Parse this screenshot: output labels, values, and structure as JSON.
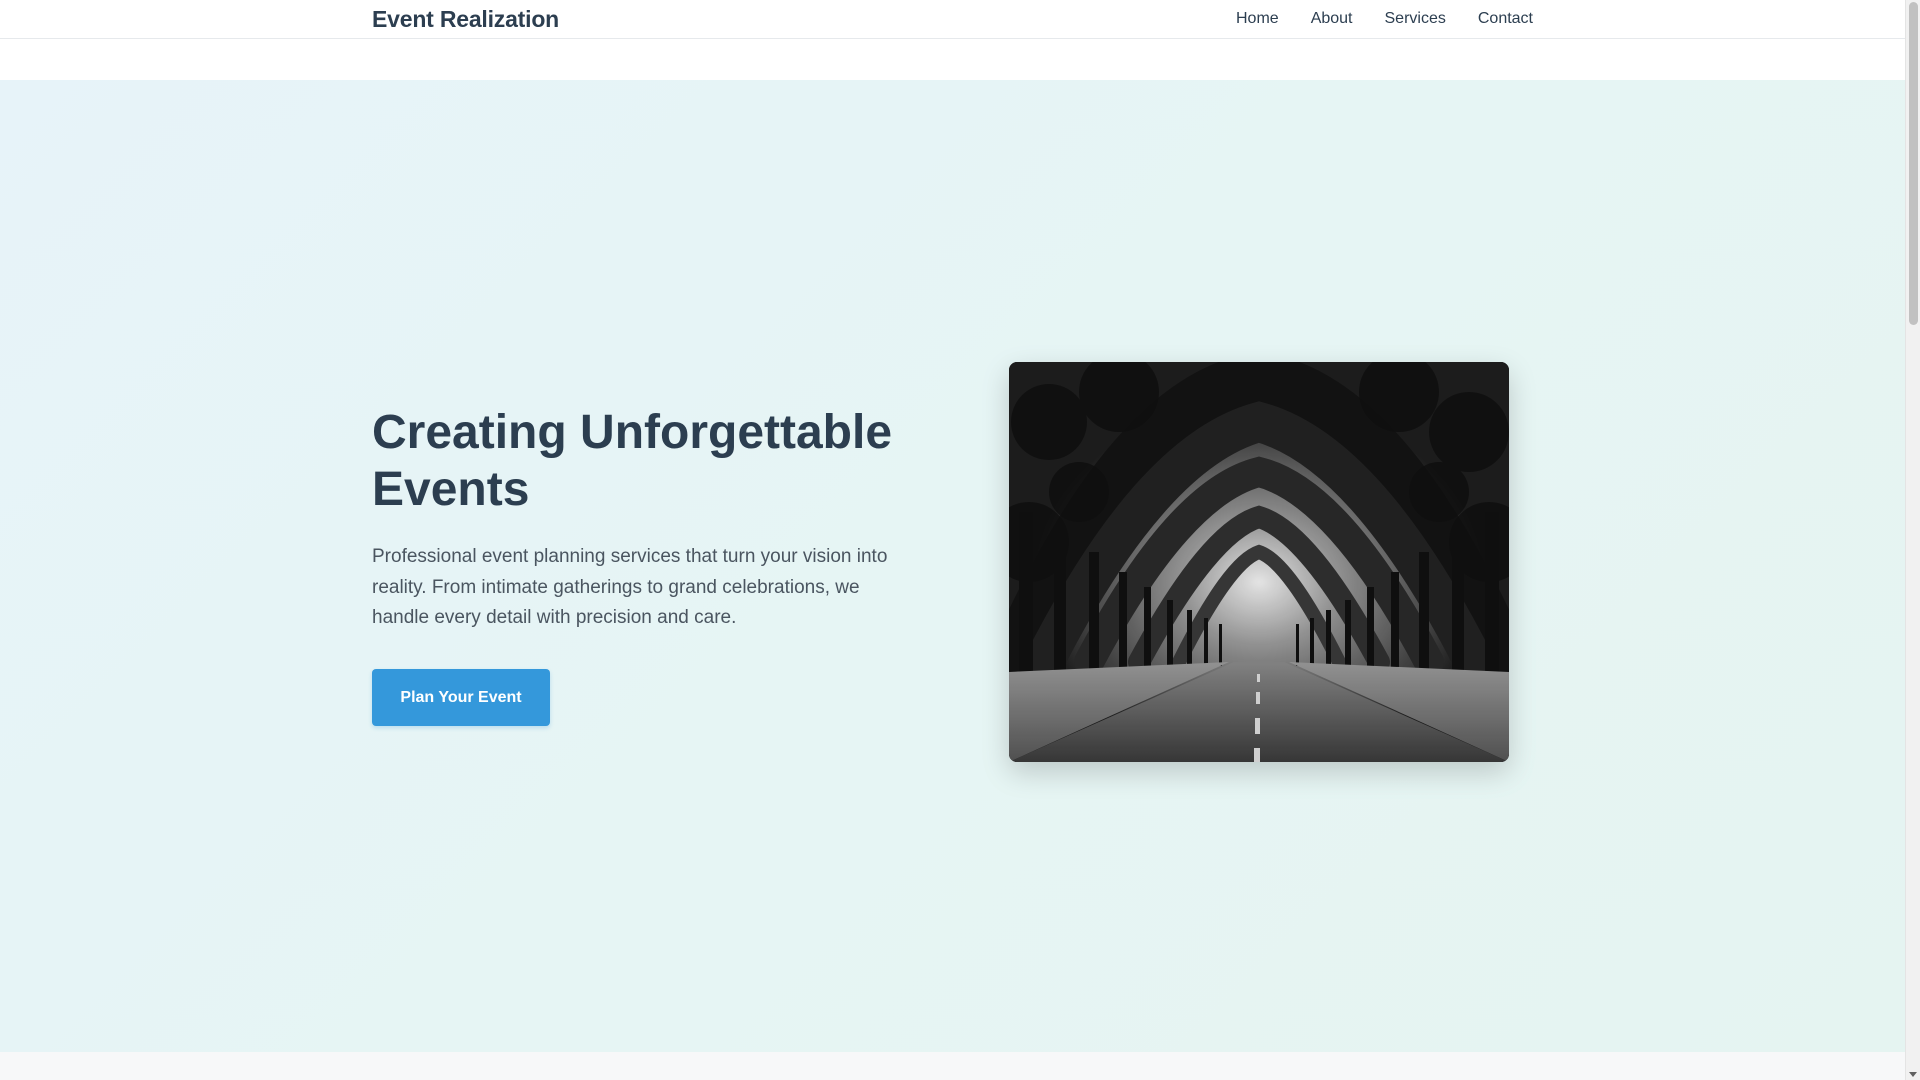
{
  "header": {
    "brand": "Event Realization",
    "nav": [
      {
        "label": "Home"
      },
      {
        "label": "About"
      },
      {
        "label": "Services"
      },
      {
        "label": "Contact"
      }
    ]
  },
  "hero": {
    "title": "Creating Unforgettable Events",
    "description": "Professional event planning services that turn your vision into reality. From intimate gatherings to grand celebrations, we handle every detail with precision and care.",
    "button_label": "Plan Your Event",
    "image_icon": "tree-lined-road-photo"
  },
  "colors": {
    "brand_text": "#2c3e50",
    "accent": "#3498db",
    "hero_bg_start": "#e7f3f9",
    "hero_bg_end": "#e5f4f1"
  }
}
